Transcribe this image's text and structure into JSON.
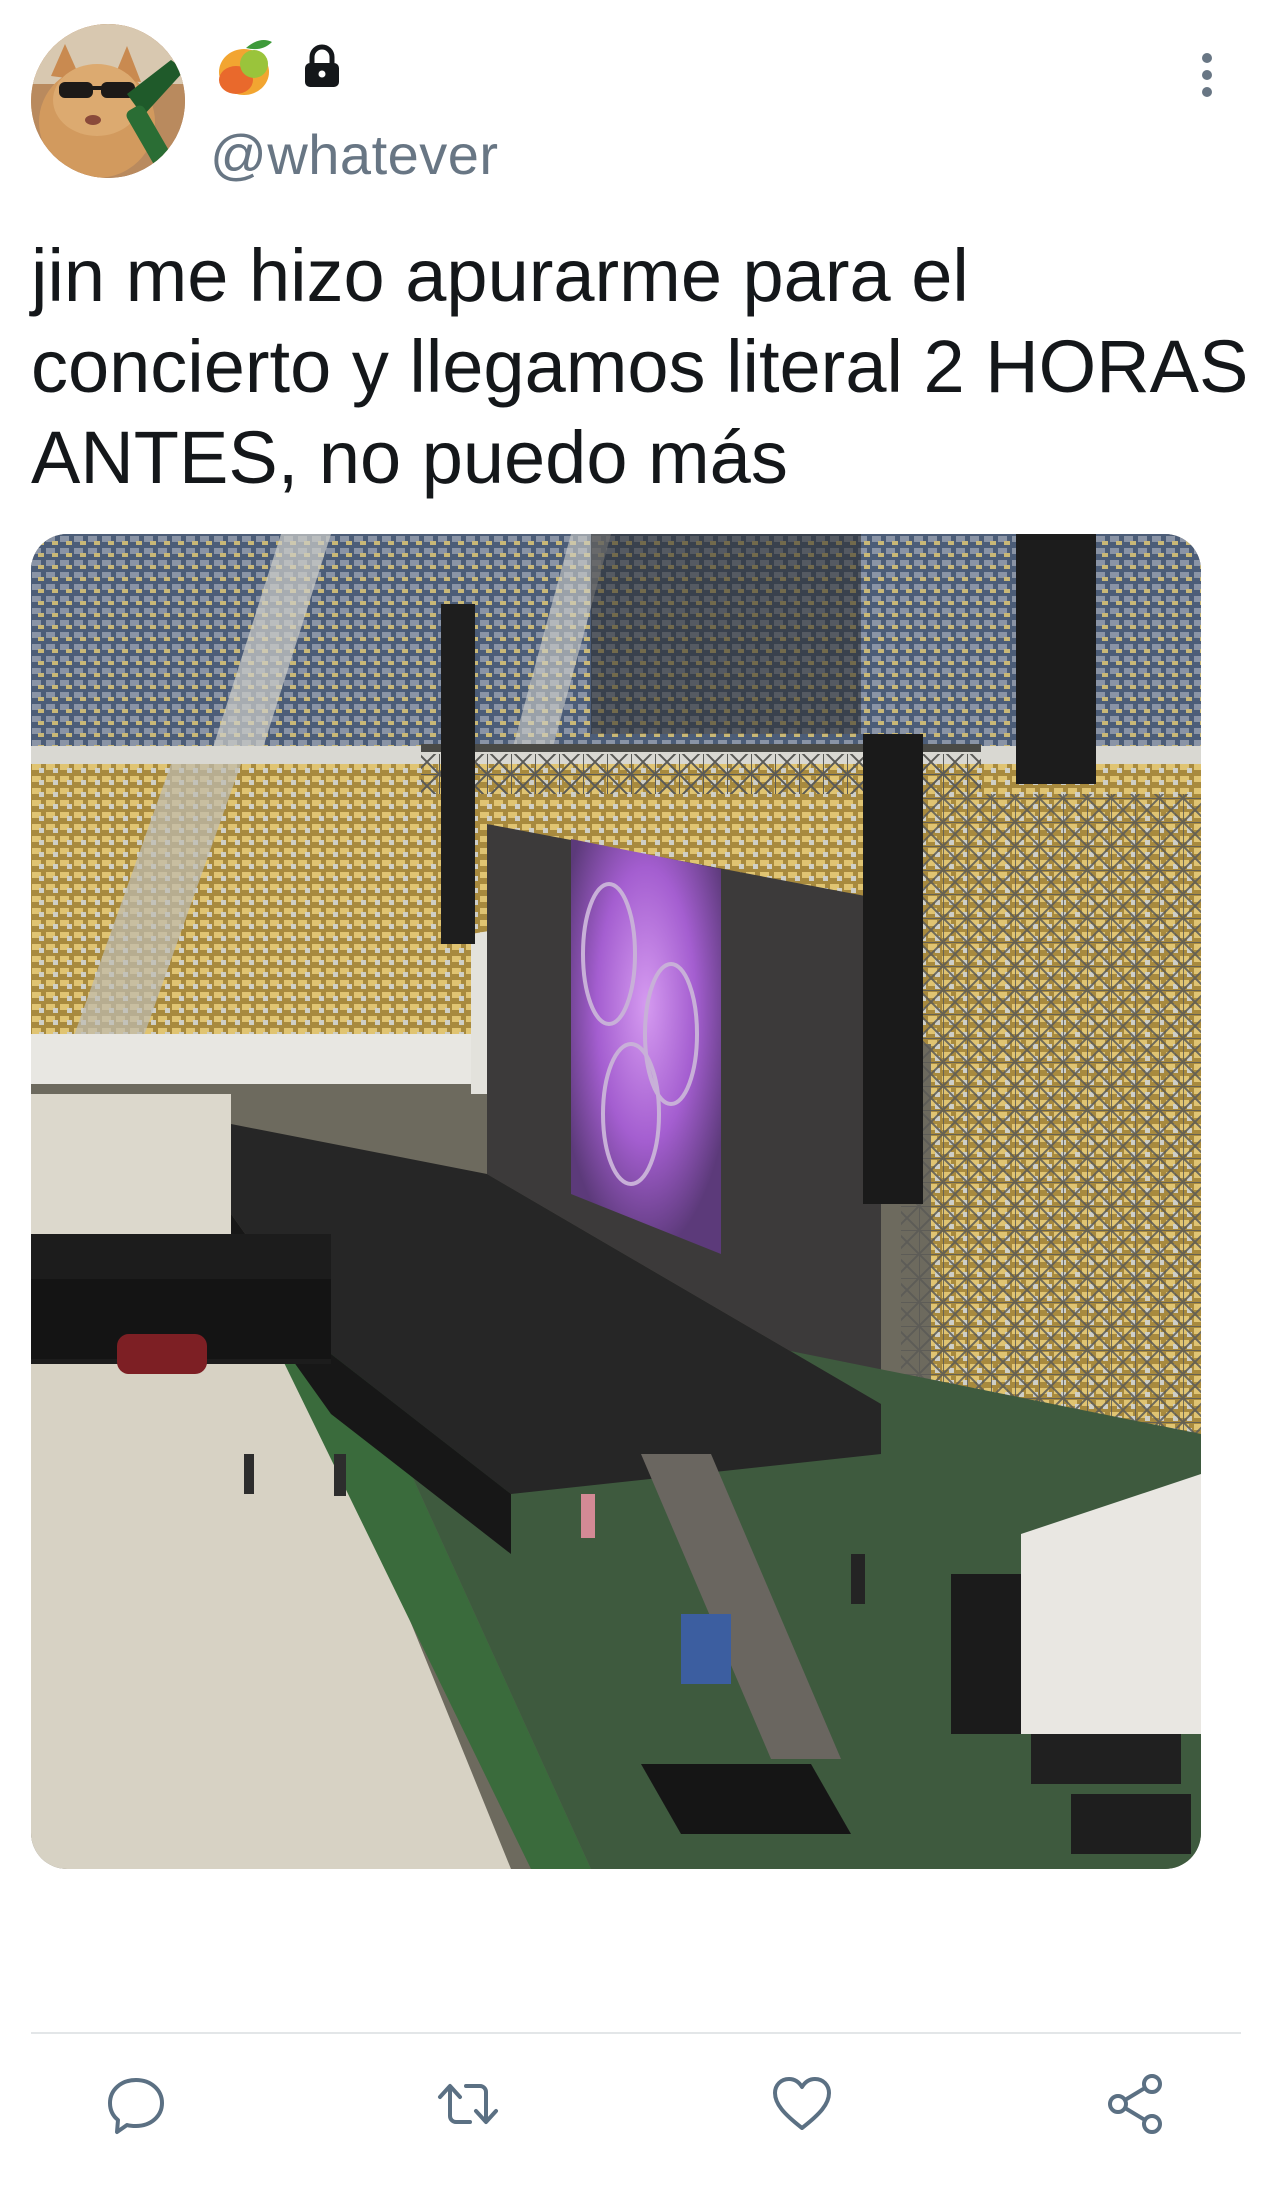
{
  "tweet": {
    "handle": "@whatever",
    "text": "jin me hizo apurarme para el concierto y llegamos literal 2 HORAS ANTES, no puedo más",
    "badges": [
      "mango-icon",
      "lock-icon"
    ],
    "avatar": "cat-with-sunglasses-avatar",
    "media": "stadium-concert-stage-photo"
  },
  "actions": [
    {
      "name": "reply",
      "icon": "reply-icon"
    },
    {
      "name": "retweet",
      "icon": "retweet-icon"
    },
    {
      "name": "like",
      "icon": "heart-icon"
    },
    {
      "name": "share",
      "icon": "share-icon"
    }
  ],
  "colors": {
    "text": "#14171a",
    "secondary": "#687684",
    "icon": "#5b7083",
    "divider": "#e3e6e8"
  }
}
